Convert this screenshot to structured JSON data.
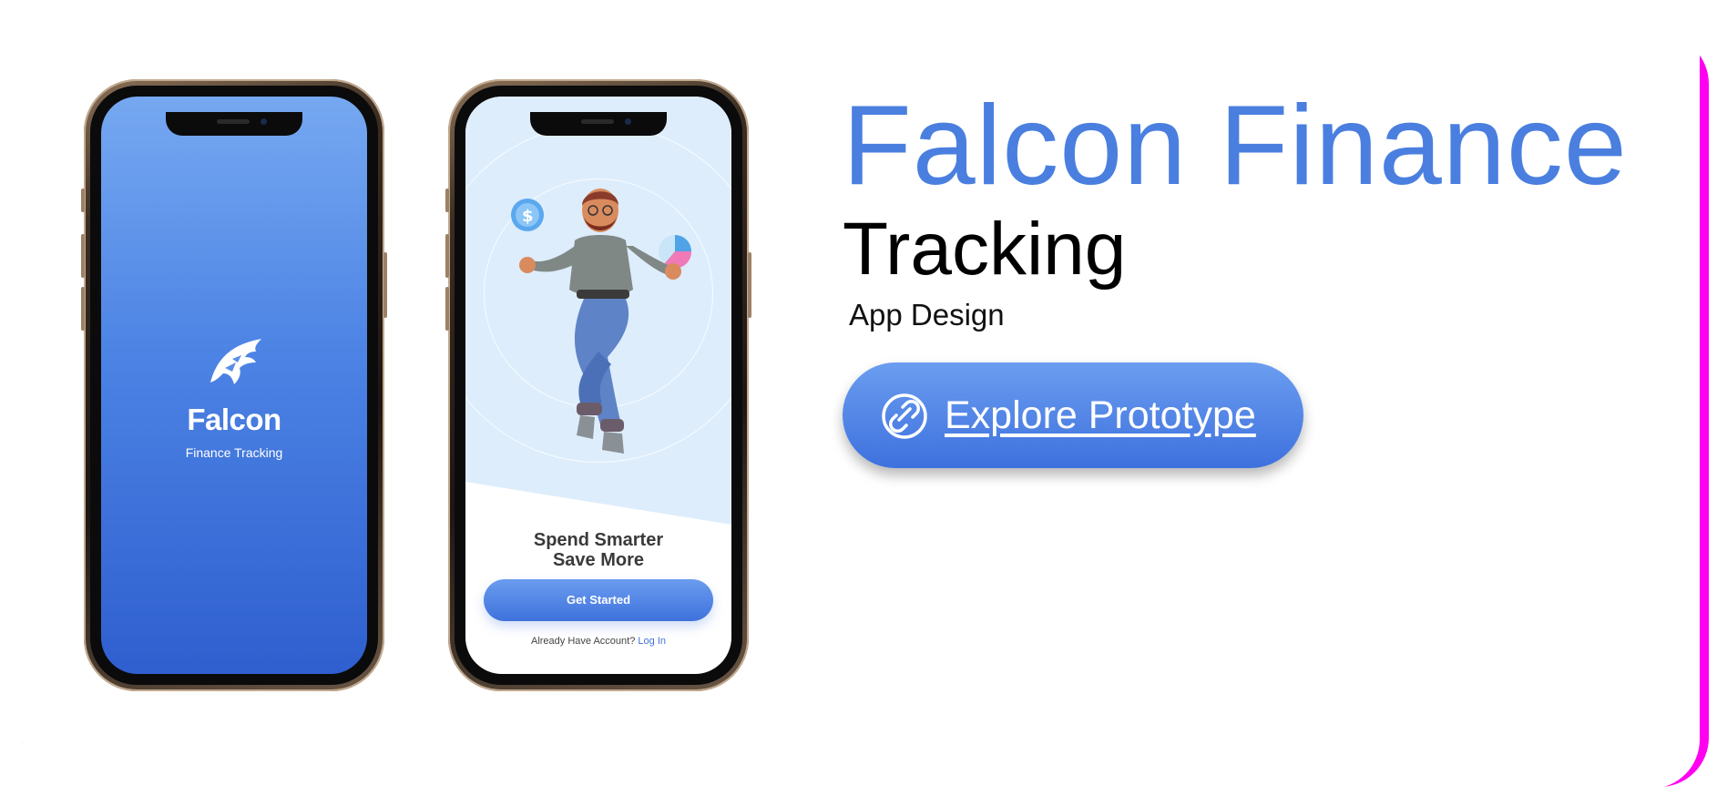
{
  "colors": {
    "accent": "#4a7fe0",
    "frame": "#ff00f0",
    "background": "#ffffff"
  },
  "phones": {
    "splash": {
      "logo": "falcon-logo-icon",
      "title": "Falcon",
      "subtitle": "Finance Tracking"
    },
    "onboarding": {
      "headline_line1": "Spend Smarter",
      "headline_line2": "Save More",
      "button_label": "Get Started",
      "login_prompt": "Already Have Account?",
      "login_link": "Log In"
    }
  },
  "hero": {
    "title": "Falcon Finance",
    "subtitle": "Tracking",
    "tagline": "App Design",
    "cta_label": "Explore Prototype",
    "cta_icon": "link-icon"
  }
}
